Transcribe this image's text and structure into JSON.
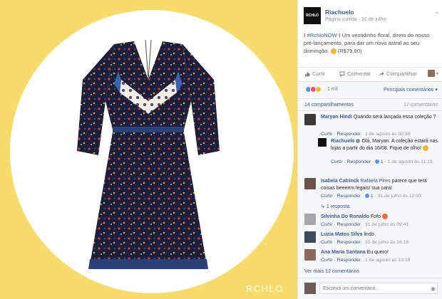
{
  "photo": {
    "watermark": "RCHLO"
  },
  "post": {
    "logo_text": "RCHLO",
    "page_name": "Riachuelo",
    "page_type": "Página curtida",
    "date": "31 de julho",
    "hashtag": "#RchloNOW",
    "body": "Um vestidinho floral, direto do nosso pré-lançamento, para dar um novo astral ao seu domingão.",
    "price": "(R$79,90)"
  },
  "actions": {
    "like": "Curtir",
    "comment": "Comentar",
    "share": "Compartilhar"
  },
  "reactions": {
    "count": "1 mil",
    "top_comments": "Principais comentários ▾"
  },
  "meta": {
    "shares": "14 compartilhamentos",
    "comments": "17 comentários"
  },
  "comments": [
    {
      "name": "Maryan Hindi",
      "text": "Quando será lançada essa coleção ?",
      "actions": "Curtir · Responder",
      "time": "· 1 de agosto às 02:39"
    },
    {
      "name": "Riachuelo",
      "text": "Olá, Maryan. A coleção estará nas lojas a partir do dia 16/08. Fique de olho!",
      "actions": "Curtir · Responder",
      "likes": "1",
      "time": "· 1 de agosto às 11:13"
    },
    {
      "name": "Isabela Catrinck",
      "mention": "Rafaela Pires",
      "text": "parece que terá coisas beeeem legais! sua cara!",
      "actions": "Curtir · Responder",
      "likes": "1",
      "time": "· 31 de julho às 12:03"
    },
    {
      "name": "Silvinha Do Ronaldo",
      "text": "Fofo",
      "actions": "Curtir · Responder",
      "time": "· 31 de julho às 09:41"
    },
    {
      "name": "Luzia Matos Silva",
      "text": "lindo",
      "actions": "Curtir · Responder",
      "time": "· 31 de julho às 16:16"
    },
    {
      "name": "Ana Maria Santana",
      "text": "Eu quero!",
      "actions": "Curtir · Responder",
      "time": "· 1 de agosto às 13:19"
    }
  ],
  "more_replies": "1 resposta",
  "see_more": "Ver mais 12 comentários",
  "write_placeholder": "Escreva um comentário...",
  "colors": {
    "background_yellow": "#f6da6a",
    "link_blue": "#365899",
    "accent_red": "#e02424"
  }
}
